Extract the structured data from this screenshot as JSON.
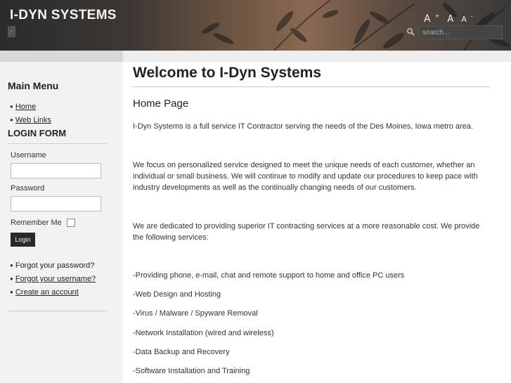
{
  "header": {
    "site_title": "I-DYN SYSTEMS",
    "tagline_mark": "·",
    "font_tools": {
      "increase": "A",
      "reset": "A",
      "decrease": "A",
      "increase_sup": "+",
      "decrease_sup": "-"
    },
    "search": {
      "placeholder": "search..."
    }
  },
  "sidebar": {
    "main_menu_title": "Main Menu",
    "menu_items": [
      {
        "label": "Home"
      },
      {
        "label": "Web Links"
      }
    ],
    "login": {
      "title": "LOGIN FORM",
      "username_label": "Username",
      "password_label": "Password",
      "remember_label": "Remember Me",
      "button_label": "Login",
      "links": [
        {
          "label": "Forgot your password?"
        },
        {
          "label": "Forgot your username?"
        },
        {
          "label": "Create an account"
        }
      ]
    }
  },
  "main": {
    "page_title": "Welcome to I-Dyn Systems",
    "subhead": "Home Page",
    "paragraphs": [
      "I-Dyn Systems is a full service IT Contractor serving the needs of the Des Moines, Iowa metro area.",
      "We focus on personalized service designed to meet the unique needs of each customer, whether an individual or small business. We will continue to modify and update our procedures to keep pace with industry developments as well as the continually changing needs of our customers.",
      "We are dedicated to providing superior IT contracting  services at a more reasonable cost.  We provide the following services:"
    ],
    "services": [
      "-Providing phone, e-mail, chat and remote support to home and office PC users",
      "-Web Design and Hosting",
      "-Virus / Malware / Spyware  Removal",
      "-Network Installation  (wired and wireless)",
      "-Data Backup and Recovery",
      "-Software Installation and Training"
    ]
  }
}
